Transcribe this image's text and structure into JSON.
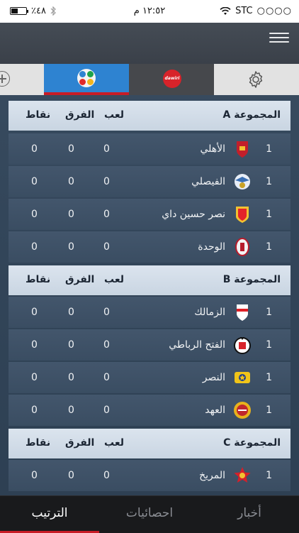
{
  "status": {
    "battery": "٪٤٨",
    "time": "١٢:٥٢ م",
    "carrier": "STC",
    "signal_dots": "○○○○"
  },
  "bottom_tabs": [
    "الترتيب",
    "احصائيات",
    "أخبار"
  ],
  "sponsor": "dawiri",
  "headers": {
    "played": "لعب",
    "diff": "الفرق",
    "points": "نقاط"
  },
  "groups": [
    {
      "name": "المجموعة A",
      "teams": [
        {
          "rank": "1",
          "name": "الأهلي",
          "played": "0",
          "diff": "0",
          "points": "0",
          "logo_color": "#c21f2b",
          "logo": "ahly-logo-icon"
        },
        {
          "rank": "1",
          "name": "الفيصلي",
          "played": "0",
          "diff": "0",
          "points": "0",
          "logo_color": "#3a6fb3",
          "logo": "faisaly-logo-icon"
        },
        {
          "rank": "1",
          "name": "نصر حسين داي",
          "played": "0",
          "diff": "0",
          "points": "0",
          "logo_color": "#e3232a",
          "logo": "nahd-logo-icon"
        },
        {
          "rank": "1",
          "name": "الوحدة",
          "played": "0",
          "diff": "0",
          "points": "0",
          "logo_color": "#b71c2c",
          "logo": "wahda-logo-icon"
        }
      ]
    },
    {
      "name": "المجموعة B",
      "teams": [
        {
          "rank": "1",
          "name": "الزمالك",
          "played": "0",
          "diff": "0",
          "points": "0",
          "logo_color": "#e01f26",
          "logo": "zamalek-logo-icon"
        },
        {
          "rank": "1",
          "name": "الفتح الرباطي",
          "played": "0",
          "diff": "0",
          "points": "0",
          "logo_color": "#111111",
          "logo": "fath-logo-icon"
        },
        {
          "rank": "1",
          "name": "النصر",
          "played": "0",
          "diff": "0",
          "points": "0",
          "logo_color": "#f0c419",
          "logo": "nassr-logo-icon"
        },
        {
          "rank": "1",
          "name": "العهد",
          "played": "0",
          "diff": "0",
          "points": "0",
          "logo_color": "#e8b21c",
          "logo": "ahed-logo-icon"
        }
      ]
    },
    {
      "name": "المجموعة C",
      "teams": [
        {
          "rank": "1",
          "name": "المريخ",
          "played": "0",
          "diff": "0",
          "points": "0",
          "logo_color": "#d4202a",
          "logo": "merreikh-logo-icon"
        }
      ]
    }
  ]
}
